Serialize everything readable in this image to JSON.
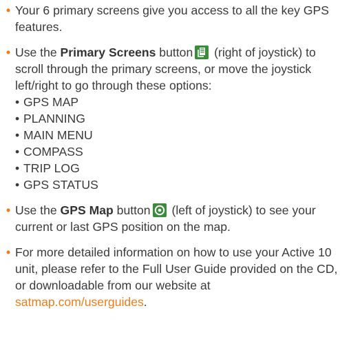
{
  "colors": {
    "accent": "#ef7d1a",
    "text": "#3a3a3a",
    "button_bg": "#3a8b3a"
  },
  "icons": {
    "primary_screens": "pages-icon",
    "gps_map": "target-icon"
  },
  "items": [
    {
      "text": "Your 6 primary screens give you access to all the key GPS features."
    },
    {
      "pre": "Use the ",
      "bold": "Primary Screens",
      "mid": " button",
      "post": " (right of joystick) to scroll through the primary screens, or move the joystick left/right to go through these options:",
      "options": [
        "GPS MAP",
        "PLANNING",
        "MAIN MENU",
        "COMPASS",
        "TRIP LOG",
        "GPS STATUS"
      ]
    },
    {
      "pre": "Use the ",
      "bold": "GPS Map",
      "mid": " button",
      "post": " (left of joystick) to see your current or last GPS position on the map."
    },
    {
      "text": "For more detailed information on how to use your Active 10 unit, please refer to the Full User Guide provided on the CD, or downloadable from our website at ",
      "link": "satmap.com/userguides",
      "suffix": "."
    }
  ]
}
